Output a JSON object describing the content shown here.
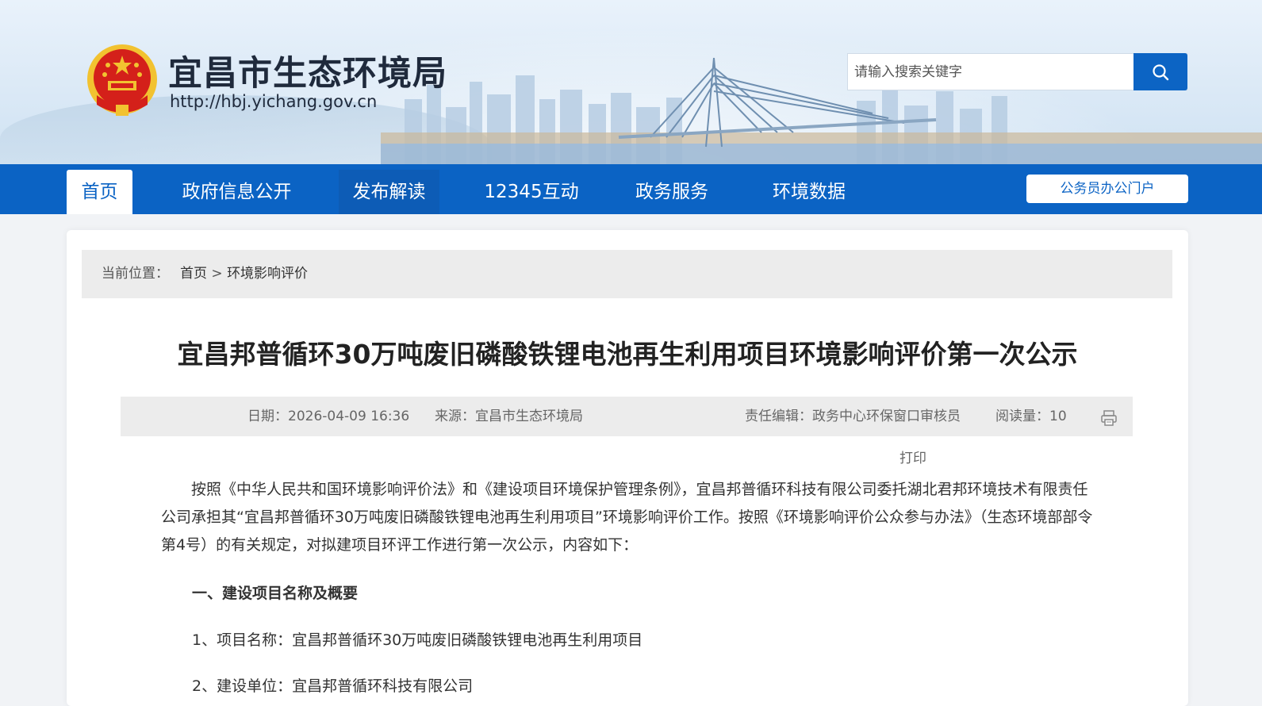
{
  "header": {
    "site_title": "宜昌市生态环境局",
    "site_url": "http://hbj.yichang.gov.cn",
    "search_placeholder": "请输入搜索关键字"
  },
  "nav": {
    "items": [
      {
        "label": "首页"
      },
      {
        "label": "政府信息公开"
      },
      {
        "label": "发布解读"
      },
      {
        "label": "12345互动"
      },
      {
        "label": "政务服务"
      },
      {
        "label": "环境数据"
      }
    ],
    "portal_label": "公务员办公门户"
  },
  "breadcrumb": {
    "prefix": "当前位置：",
    "home": "首页",
    "sep": " > ",
    "current": "环境影响评价"
  },
  "article": {
    "title": "宜昌邦普循环30万吨废旧磷酸铁锂电池再生利用项目环境影响评价第一次公示",
    "meta": {
      "date": "日期：2026-04-09 16:36",
      "source": "来源：宜昌市生态环境局",
      "editor": "责任编辑：政务中心环保窗口审核员",
      "reads": "阅读量：10"
    },
    "print_label": "打印",
    "paragraph": "按照《中华人民共和国环境影响评价法》和《建设项目环境保护管理条例》，宜昌邦普循环科技有限公司委托湖北君邦环境技术有限责任公司承担其“宜昌邦普循环30万吨废旧磷酸铁锂电池再生利用项目”环境影响评价工作。按照《环境影响评价公众参与办法》（生态环境部部令第4号）的有关规定，对拟建项目环评工作进行第一次公示，内容如下：",
    "section_heading": "一、建设项目名称及概要",
    "item1": "1、项目名称：宜昌邦普循环30万吨废旧磷酸铁锂电池再生利用项目",
    "item2": "2、建设单位：宜昌邦普循环科技有限公司"
  },
  "colors": {
    "nav_blue": "#0b63c4",
    "banner_sky": "#dbe9f6",
    "emblem_red": "#d4201a",
    "emblem_gold": "#f2c230"
  },
  "icons": {
    "search": "search-icon",
    "print": "printer-icon",
    "emblem": "national-emblem-icon"
  }
}
